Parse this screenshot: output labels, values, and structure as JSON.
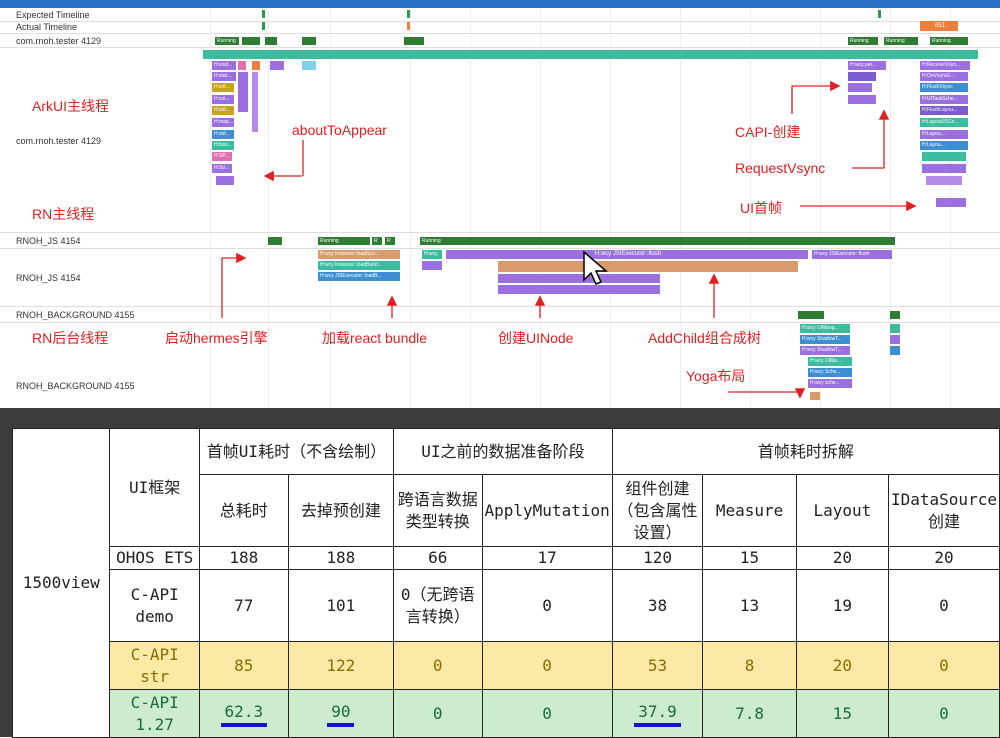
{
  "trace": {
    "tracks": {
      "expected_timeline": "Expected Timeline",
      "actual_timeline": "Actual Timeline",
      "tester_4129": "com.rnoh.tester 4129",
      "tester_4129_detail": "com.rnoh.tester 4129",
      "js_4154": "RNOH_JS 4154",
      "js_4154_detail": "RNOH_JS 4154",
      "bg_4155": "RNOH_BACKGROUND 4155",
      "bg_4155_detail": "RNOH_BACKGROUND 4155"
    },
    "actual_badge": "651",
    "main_thread_slice": "H:static void OHOS::AppExecFwk::MainThread::Start()",
    "running": "Running",
    "r": "R",
    "js_slices": {
      "load_script": "H:wcy Instance::loadScri...",
      "load_bundle": "H:wcy Instance::loadBund...",
      "executor_load": "H:wcy JSIExecutor::loadB...",
      "flush": "H:wcy JSIExecutor::flush",
      "flush2": "H:wcy JSIExecutor::flush",
      "hwcy": "H:wcy"
    },
    "bg_slices": [
      "H:wcy UIMang...",
      "H:wcy ShadowT...",
      "H:wcy ShadowT...",
      "H:wcy UIMa...",
      "H:wcy Sche...",
      "H:wcy sche..."
    ],
    "main_slices_left": [
      "H:void...",
      "H:stat...",
      "H:virt...",
      "H:voi...",
      "H:std...",
      "H:map...",
      "H:std...",
      "H:boo...",
      "H:SP...",
      "H:So..."
    ],
    "main_slices_right": [
      "H:ReceiveVsyn...",
      "H:OnVsyncE...",
      "H:FlushVsync",
      "H:UITaskSche...",
      "H:FlushLayou...",
      "H:LayoutJSCo...",
      "H:Layou...",
      "H:Layou..."
    ],
    "capi_slice": "H:wcy per...",
    "annotations": {
      "arkui_main": "ArkUI主线程",
      "rn_main": "RN主线程",
      "rn_bg": "RN后台线程",
      "about_to_appear": "aboutToAppear",
      "capi_create": "CAPI-创建",
      "request_vsync": "RequestVsync",
      "ui_first_frame": "UI首帧",
      "start_hermes": "启动hermes引擎",
      "load_bundle": "加载react bundle",
      "create_uinode": "创建UINode",
      "add_child": "AddChild组合成树",
      "yoga": "Yoga布局"
    }
  },
  "table": {
    "group_label": "1500view",
    "framework_header": "UI框架",
    "h_first_frame": "首帧UI耗时（不含绘制）",
    "h_prep": "UI之前的数据准备阶段",
    "h_breakdown": "首帧耗时拆解",
    "sub": [
      "总耗时",
      "去掉预创建",
      "跨语言数据类型转换",
      "ApplyMutation",
      "组件创建（包含属性设置）",
      "Measure",
      "Layout",
      "IDataSource创建"
    ],
    "rows": [
      {
        "name": "OHOS ETS",
        "values": [
          "188",
          "188",
          "66",
          "17",
          "120",
          "15",
          "20",
          "20"
        ]
      },
      {
        "name": "C-API demo",
        "values": [
          "77",
          "101",
          "0（无跨语言转换）",
          "0",
          "38",
          "13",
          "19",
          "0"
        ]
      },
      {
        "name": "C-API str",
        "values": [
          "85",
          "122",
          "0",
          "0",
          "53",
          "8",
          "20",
          "0"
        ]
      },
      {
        "name": "C-API 1.27",
        "values": [
          "62.3",
          "90",
          "0",
          "0",
          "37.9",
          "7.8",
          "15",
          "0"
        ]
      }
    ]
  },
  "colors": {
    "running": "#2e7d32",
    "slice_teal": "#3dbb9f",
    "slice_purple": "#9b6fe0",
    "slice_orange": "#f07f3c",
    "annotation_red": "#e02020",
    "yellow_row": "#fce9a6",
    "green_row": "#cdeccd",
    "underline": "#1414c8"
  }
}
